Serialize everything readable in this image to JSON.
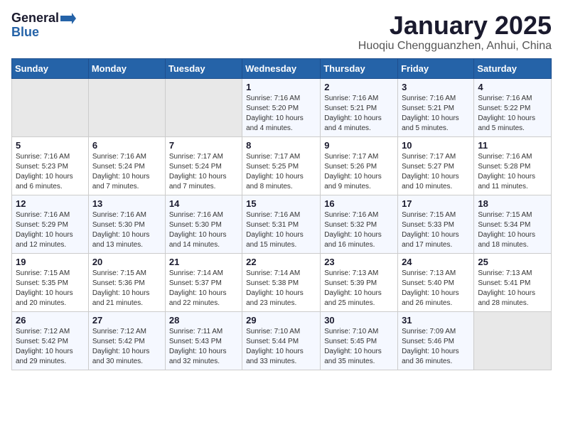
{
  "header": {
    "logo_general": "General",
    "logo_blue": "Blue",
    "title": "January 2025",
    "subtitle": "Huoqiu Chengguanzhen, Anhui, China"
  },
  "weekdays": [
    "Sunday",
    "Monday",
    "Tuesday",
    "Wednesday",
    "Thursday",
    "Friday",
    "Saturday"
  ],
  "weeks": [
    [
      {
        "day": "",
        "info": ""
      },
      {
        "day": "",
        "info": ""
      },
      {
        "day": "",
        "info": ""
      },
      {
        "day": "1",
        "info": "Sunrise: 7:16 AM\nSunset: 5:20 PM\nDaylight: 10 hours\nand 4 minutes."
      },
      {
        "day": "2",
        "info": "Sunrise: 7:16 AM\nSunset: 5:21 PM\nDaylight: 10 hours\nand 4 minutes."
      },
      {
        "day": "3",
        "info": "Sunrise: 7:16 AM\nSunset: 5:21 PM\nDaylight: 10 hours\nand 5 minutes."
      },
      {
        "day": "4",
        "info": "Sunrise: 7:16 AM\nSunset: 5:22 PM\nDaylight: 10 hours\nand 5 minutes."
      }
    ],
    [
      {
        "day": "5",
        "info": "Sunrise: 7:16 AM\nSunset: 5:23 PM\nDaylight: 10 hours\nand 6 minutes."
      },
      {
        "day": "6",
        "info": "Sunrise: 7:16 AM\nSunset: 5:24 PM\nDaylight: 10 hours\nand 7 minutes."
      },
      {
        "day": "7",
        "info": "Sunrise: 7:17 AM\nSunset: 5:24 PM\nDaylight: 10 hours\nand 7 minutes."
      },
      {
        "day": "8",
        "info": "Sunrise: 7:17 AM\nSunset: 5:25 PM\nDaylight: 10 hours\nand 8 minutes."
      },
      {
        "day": "9",
        "info": "Sunrise: 7:17 AM\nSunset: 5:26 PM\nDaylight: 10 hours\nand 9 minutes."
      },
      {
        "day": "10",
        "info": "Sunrise: 7:17 AM\nSunset: 5:27 PM\nDaylight: 10 hours\nand 10 minutes."
      },
      {
        "day": "11",
        "info": "Sunrise: 7:16 AM\nSunset: 5:28 PM\nDaylight: 10 hours\nand 11 minutes."
      }
    ],
    [
      {
        "day": "12",
        "info": "Sunrise: 7:16 AM\nSunset: 5:29 PM\nDaylight: 10 hours\nand 12 minutes."
      },
      {
        "day": "13",
        "info": "Sunrise: 7:16 AM\nSunset: 5:30 PM\nDaylight: 10 hours\nand 13 minutes."
      },
      {
        "day": "14",
        "info": "Sunrise: 7:16 AM\nSunset: 5:30 PM\nDaylight: 10 hours\nand 14 minutes."
      },
      {
        "day": "15",
        "info": "Sunrise: 7:16 AM\nSunset: 5:31 PM\nDaylight: 10 hours\nand 15 minutes."
      },
      {
        "day": "16",
        "info": "Sunrise: 7:16 AM\nSunset: 5:32 PM\nDaylight: 10 hours\nand 16 minutes."
      },
      {
        "day": "17",
        "info": "Sunrise: 7:15 AM\nSunset: 5:33 PM\nDaylight: 10 hours\nand 17 minutes."
      },
      {
        "day": "18",
        "info": "Sunrise: 7:15 AM\nSunset: 5:34 PM\nDaylight: 10 hours\nand 18 minutes."
      }
    ],
    [
      {
        "day": "19",
        "info": "Sunrise: 7:15 AM\nSunset: 5:35 PM\nDaylight: 10 hours\nand 20 minutes."
      },
      {
        "day": "20",
        "info": "Sunrise: 7:15 AM\nSunset: 5:36 PM\nDaylight: 10 hours\nand 21 minutes."
      },
      {
        "day": "21",
        "info": "Sunrise: 7:14 AM\nSunset: 5:37 PM\nDaylight: 10 hours\nand 22 minutes."
      },
      {
        "day": "22",
        "info": "Sunrise: 7:14 AM\nSunset: 5:38 PM\nDaylight: 10 hours\nand 23 minutes."
      },
      {
        "day": "23",
        "info": "Sunrise: 7:13 AM\nSunset: 5:39 PM\nDaylight: 10 hours\nand 25 minutes."
      },
      {
        "day": "24",
        "info": "Sunrise: 7:13 AM\nSunset: 5:40 PM\nDaylight: 10 hours\nand 26 minutes."
      },
      {
        "day": "25",
        "info": "Sunrise: 7:13 AM\nSunset: 5:41 PM\nDaylight: 10 hours\nand 28 minutes."
      }
    ],
    [
      {
        "day": "26",
        "info": "Sunrise: 7:12 AM\nSunset: 5:42 PM\nDaylight: 10 hours\nand 29 minutes."
      },
      {
        "day": "27",
        "info": "Sunrise: 7:12 AM\nSunset: 5:42 PM\nDaylight: 10 hours\nand 30 minutes."
      },
      {
        "day": "28",
        "info": "Sunrise: 7:11 AM\nSunset: 5:43 PM\nDaylight: 10 hours\nand 32 minutes."
      },
      {
        "day": "29",
        "info": "Sunrise: 7:10 AM\nSunset: 5:44 PM\nDaylight: 10 hours\nand 33 minutes."
      },
      {
        "day": "30",
        "info": "Sunrise: 7:10 AM\nSunset: 5:45 PM\nDaylight: 10 hours\nand 35 minutes."
      },
      {
        "day": "31",
        "info": "Sunrise: 7:09 AM\nSunset: 5:46 PM\nDaylight: 10 hours\nand 36 minutes."
      },
      {
        "day": "",
        "info": ""
      }
    ]
  ]
}
